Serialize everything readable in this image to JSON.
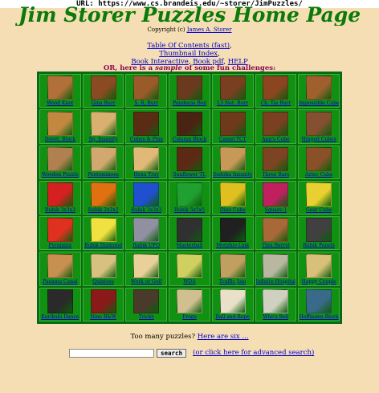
{
  "url_bar": "URL: https://www.cs.brandeis.edu/~storer/JimPuzzles/",
  "title": "Jim Storer Puzzles Home Page",
  "copyright": {
    "prefix": "Copyright (c) ",
    "author": "James A. Storer"
  },
  "links": {
    "toc": "Table Of Contents (fast)",
    "thumbnail": "Thumbnail Index",
    "book_interactive": "Book Interactive",
    "book_pdf": "Book pdf",
    "help": "HELP"
  },
  "challenge": {
    "before": "OR, here is a ",
    "sample": "sample",
    "after": " of some fun challenges:"
  },
  "puzzles": [
    {
      "name": "Wood Knot",
      "color": "#b07038"
    },
    {
      "name": "Gina Burr",
      "color": "#8a4a22"
    },
    {
      "name": "S. R. Burr",
      "color": "#9b5a2a"
    },
    {
      "name": "Pandoras Box",
      "color": "#6b3a1e"
    },
    {
      "name": "L5 Net. Burr",
      "color": "#7a3e20"
    },
    {
      "name": "Ch. Tie Burr",
      "color": "#8c4520"
    },
    {
      "name": "Impossible Cube",
      "color": "#a0602e"
    },
    {
      "name": "Dovet. Block",
      "color": "#c28840"
    },
    {
      "name": "Sq. Insanity",
      "color": "#d8b070"
    },
    {
      "name": "Cubes & Pins",
      "color": "#5a2c14"
    },
    {
      "name": "Column Block",
      "color": "#4a2412"
    },
    {
      "name": "Camel TCT",
      "color": "#6e3a1a"
    },
    {
      "name": "Ann's Cube",
      "color": "#7a4020"
    },
    {
      "name": "Hinged Cubes",
      "color": "#845030"
    },
    {
      "name": "Wooden Puzzle",
      "color": "#b08050"
    },
    {
      "name": "Pentominoes",
      "color": "#d2a870"
    },
    {
      "name": "Hexa Tray",
      "color": "#e0b878"
    },
    {
      "name": "Sunflower TL",
      "color": "#5c2a14"
    },
    {
      "name": "Sudoku Insanity",
      "color": "#c89858"
    },
    {
      "name": "Three Bars",
      "color": "#7c4422"
    },
    {
      "name": "Aztec Cube",
      "color": "#8a5028"
    },
    {
      "name": "Rubik 3x3x3",
      "color": "#d42020"
    },
    {
      "name": "Rubik 2x2x2",
      "color": "#e07010"
    },
    {
      "name": "Rubik 3x3x3",
      "color": "#2050d0"
    },
    {
      "name": "Rubik 5x5x5",
      "color": "#20a030"
    },
    {
      "name": "Dino Cube",
      "color": "#e0c020"
    },
    {
      "name": "Square-1",
      "color": "#c02060"
    },
    {
      "name": "Gear Cube",
      "color": "#e8d030"
    },
    {
      "name": "Pyraminx",
      "color": "#e03020"
    },
    {
      "name": "Rubik Diamond",
      "color": "#f0e040"
    },
    {
      "name": "Rubik UFO",
      "color": "#9090a0"
    },
    {
      "name": "Masterball",
      "color": "#303030"
    },
    {
      "name": "Morphio Link",
      "color": "#202020"
    },
    {
      "name": "Thin Barrel",
      "color": "#a86838"
    },
    {
      "name": "Rubik Panels",
      "color": "#404040"
    },
    {
      "name": "Panama Canal",
      "color": "#c89050"
    },
    {
      "name": "Quintess",
      "color": "#d8c080"
    },
    {
      "name": "Work or Golf",
      "color": "#e8d098"
    },
    {
      "name": "WDA",
      "color": "#d0d060"
    },
    {
      "name": "Traffic Jam",
      "color": "#c0a060"
    },
    {
      "name": "Infinite Hospital",
      "color": "#b8b8a0"
    },
    {
      "name": "Happy Couple",
      "color": "#d8c078"
    },
    {
      "name": "Kurikuki Dance",
      "color": "#2a2a2a"
    },
    {
      "name": "Nine B&W",
      "color": "#8a1a1a"
    },
    {
      "name": "Tricky",
      "color": "#4a3a2a"
    },
    {
      "name": "Frogs",
      "color": "#d0c090"
    },
    {
      "name": "Ball and Rope",
      "color": "#e8e0c8"
    },
    {
      "name": "Who's Bell",
      "color": "#d0d0c0"
    },
    {
      "name": "Hoffmann Block",
      "color": "#3a6a8a"
    }
  ],
  "too_many": {
    "text": "Too many puzzles? ",
    "link": "Here are six ..."
  },
  "search": {
    "button": "search",
    "advanced": "(or click here for advanced search)",
    "value": ""
  }
}
